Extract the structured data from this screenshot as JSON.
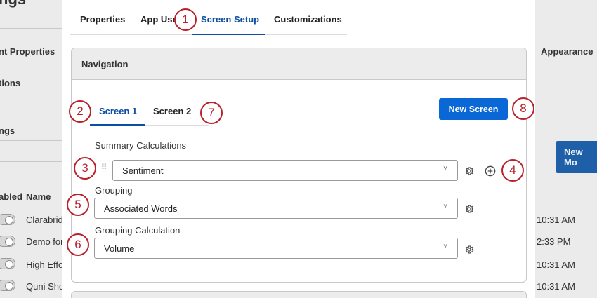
{
  "background": {
    "title_fragment": "ngs",
    "section_left_1": "nt Properties",
    "section_left_2": "tions",
    "section_left_3": "ngs",
    "appearance": "Appearance",
    "new_button": "New Mo",
    "table": {
      "header_enabled": "abled",
      "header_name": "Name",
      "rows": [
        {
          "name": "Clarabrid",
          "time": "10:31 AM"
        },
        {
          "name": "Demo for",
          "time": "2:33 PM"
        },
        {
          "name": "High Effo",
          "time": "10:31 AM"
        },
        {
          "name": "Quni Sho",
          "time": "10:31 AM"
        }
      ]
    }
  },
  "modal": {
    "tabs": [
      {
        "label": "Properties"
      },
      {
        "label": "App Use"
      },
      {
        "label": "Screen Setup"
      },
      {
        "label": "Customizations"
      }
    ],
    "navigation_title": "Navigation",
    "screen_tabs": [
      {
        "label": "Screen 1"
      },
      {
        "label": "Screen 2"
      }
    ],
    "new_screen_label": "New Screen",
    "summary_calculations_label": "Summary Calculations",
    "summary_calculations_value": "Sentiment",
    "grouping_label": "Grouping",
    "grouping_value": "Associated Words",
    "grouping_calculation_label": "Grouping Calculation",
    "grouping_calculation_value": "Volume",
    "chevron_glyph": "˅",
    "drag_glyph": "⠿"
  },
  "callouts": [
    "1",
    "2",
    "3",
    "4",
    "5",
    "6",
    "7",
    "8"
  ]
}
